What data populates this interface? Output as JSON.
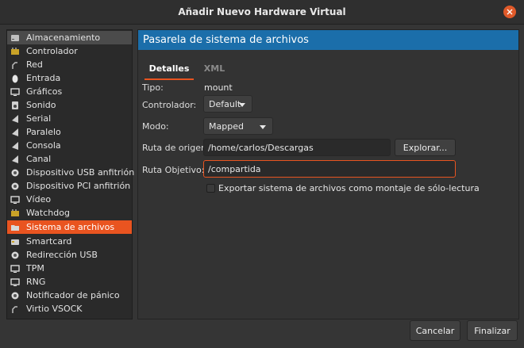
{
  "window": {
    "title": "Añadir Nuevo Hardware Virtual"
  },
  "sidebar": {
    "items": [
      {
        "label": "Almacenamiento",
        "icon": "storage-icon"
      },
      {
        "label": "Controlador",
        "icon": "controller-icon"
      },
      {
        "label": "Red",
        "icon": "network-icon"
      },
      {
        "label": "Entrada",
        "icon": "mouse-icon"
      },
      {
        "label": "Gráficos",
        "icon": "display-icon"
      },
      {
        "label": "Sonido",
        "icon": "sound-icon"
      },
      {
        "label": "Serial",
        "icon": "serial-icon"
      },
      {
        "label": "Paralelo",
        "icon": "parallel-icon"
      },
      {
        "label": "Consola",
        "icon": "console-icon"
      },
      {
        "label": "Canal",
        "icon": "channel-icon"
      },
      {
        "label": "Dispositivo USB anfitrión",
        "icon": "usb-icon"
      },
      {
        "label": "Dispositivo PCI anfitrión",
        "icon": "pci-icon"
      },
      {
        "label": "Vídeo",
        "icon": "video-icon"
      },
      {
        "label": "Watchdog",
        "icon": "watchdog-icon"
      },
      {
        "label": "Sistema de archivos",
        "icon": "folder-icon"
      },
      {
        "label": "Smartcard",
        "icon": "smartcard-icon"
      },
      {
        "label": "Redirección USB",
        "icon": "usb-redirect-icon"
      },
      {
        "label": "TPM",
        "icon": "tpm-icon"
      },
      {
        "label": "RNG",
        "icon": "rng-icon"
      },
      {
        "label": "Notificador de pánico",
        "icon": "panic-icon"
      },
      {
        "label": "Virtio VSOCK",
        "icon": "vsock-icon"
      }
    ],
    "selected_index": 14
  },
  "main": {
    "banner_title": "Pasarela de sistema de archivos",
    "tabs": [
      {
        "label": "Detalles"
      },
      {
        "label": "XML"
      }
    ],
    "form": {
      "tipo_label": "Tipo:",
      "tipo_value": "mount",
      "controlador_label": "Controlador:",
      "controlador_value": "Default",
      "modo_label": "Modo:",
      "modo_value": "Mapped",
      "ruta_origen_label": "Ruta de origen",
      "ruta_origen_value": "/home/carlos/Descargas",
      "explorar_label": "Explorar...",
      "ruta_objetivo_label": "Ruta Objetivo:",
      "ruta_objetivo_value": "/compartida",
      "readonly_label": "Exportar sistema de archivos como montaje de sólo-lectura",
      "readonly_checked": false
    }
  },
  "footer": {
    "cancel_label": "Cancelar",
    "finish_label": "Finalizar"
  },
  "colors": {
    "accent": "#e95420",
    "banner": "#1b6eaa"
  }
}
